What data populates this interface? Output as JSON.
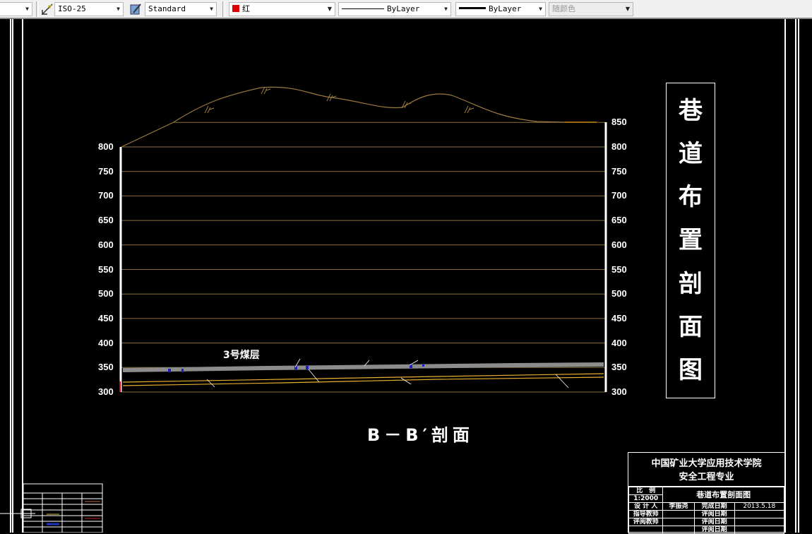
{
  "toolbar": {
    "dim_style": "ISO-25",
    "text_style": "Standard",
    "color": "红",
    "color_swatch": "#e00000",
    "linetype": "ByLayer",
    "lineweight": "ByLayer",
    "plot_style": "随颜色",
    "icons": [
      "dimension-style-icon",
      "text-style-icon"
    ]
  },
  "drawing": {
    "title_chars": [
      "巷",
      "道",
      "布",
      "置",
      "剖",
      "面",
      "图"
    ],
    "section_label": "B－B′剖面",
    "seam_label": "3号煤层",
    "left_axis": [
      "800",
      "750",
      "700",
      "650",
      "600",
      "550",
      "500",
      "450",
      "400",
      "350",
      "300"
    ],
    "right_axis": [
      "850",
      "800",
      "750",
      "700",
      "650",
      "600",
      "550",
      "500",
      "450",
      "400",
      "350",
      "300"
    ],
    "colors": {
      "background": "#000000",
      "grid": "#8a6d3b",
      "terrain": "#9a7a40",
      "seam": "#8c8c8c",
      "roadway": "#e8b030",
      "marker": "#2020c0"
    }
  },
  "title_block": {
    "school": "中国矿业大学应用技术学院",
    "major": "安全工程专业",
    "scale_label": "比　例",
    "scale_value": "1:2000",
    "drawing_name": "巷道布置剖面图",
    "rows": [
      [
        "设 计 人",
        "李振尧",
        "完成日期",
        "2013.5.18"
      ],
      [
        "指导教师",
        "",
        "评阅日期",
        ""
      ],
      [
        "评阅教师",
        "",
        "评阅日期",
        ""
      ],
      [
        "",
        "",
        "评阅日期",
        ""
      ]
    ]
  }
}
